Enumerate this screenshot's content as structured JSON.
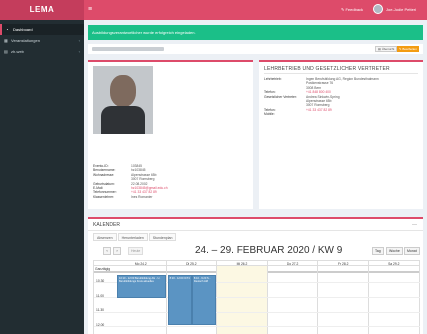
{
  "brand": "LEMA",
  "topbar": {
    "menu_icon": "bars-icon",
    "feedback": "Feedback",
    "user": "Joe-Jodie Petteri"
  },
  "sidebar": {
    "items": [
      {
        "label": "Dashboard",
        "icon": "gauge-icon",
        "active": true
      },
      {
        "label": "Veranstaltungen",
        "icon": "calendar-icon",
        "chevron": "‹"
      },
      {
        "label": "zh-web",
        "icon": "grid-icon",
        "chevron": "‹"
      }
    ]
  },
  "alert": "Ausbildungsverantwortlicher wurde erfolgreich eingeladen.",
  "toolbar": {
    "print_label": "Übersicht",
    "edit_label": "Bearbeiten"
  },
  "person": {
    "rows": [
      {
        "label": "Evento-ID:",
        "value": "103845"
      },
      {
        "label": "Benutzername:",
        "value": "hz103845"
      },
      {
        "label": "Wohnadresse:",
        "value": "Alpenstrasse 65b"
      },
      {
        "label": "",
        "value": "3007 Romsberg"
      },
      {
        "label": "Geburtsdatum:",
        "value": "22.08.2002"
      },
      {
        "label": "E-Mail:",
        "value": "hz103845@gmail.edu.ch",
        "link": true
      },
      {
        "label": "Telefonnummer:",
        "value": "+41 33 437 82 89",
        "link": true
      },
      {
        "label": "Klassenlehrer:",
        "value": "Ines Romanier"
      }
    ]
  },
  "company": {
    "title": "LEHRBETRIEB UND GESETZLICHER VERTRETER",
    "rows": [
      {
        "label": "Lehrbetrieb:",
        "lines": [
          "Ingen Berufsbildung AG, Region Bundesthalmann",
          "Postkenstrasse 76",
          "3008 Bern"
        ]
      },
      {
        "label": "Telefon:",
        "lines": [
          "+41 848 800 400"
        ],
        "link": true
      },
      {
        "label": "Gesetzlicher Vertreter:",
        "lines": [
          "Andrea Sinkwin-Spring",
          "Alpenstrasse 65b",
          "3007 Romsberg"
        ]
      },
      {
        "label": "Telefon:",
        "lines": [
          "+41 33 437 82 89"
        ],
        "link": true
      },
      {
        "label": "Mobile:",
        "lines": [
          ""
        ]
      }
    ]
  },
  "calendar": {
    "title": "KALENDER",
    "collapse": "—",
    "tabs": [
      "Absenzen",
      "Herunterladen",
      "Stundenplan"
    ],
    "prev": "‹",
    "next": "›",
    "today": "Heute",
    "range": "24. – 29. FEBRUAR 2020 / KW 9",
    "views": [
      "Tag",
      "Woche",
      "Monat"
    ],
    "days": [
      "Mo 24.2",
      "Di 25.2",
      "Mi 26.2",
      "Do 27.2",
      "Fr 28.2",
      "Sa 29.2"
    ],
    "allday": "Ganztägig",
    "times": [
      "10.30",
      "11.00",
      "11.30",
      "12.00"
    ],
    "events": [
      {
        "day": 0,
        "text": "10:10 - 12:00 Berufsbildung AG - U-Berufsbildungs Kreis aktuelles",
        "start": 0,
        "end": 1.6
      },
      {
        "day": 1,
        "text": "8:10 - 12:00 ICT4",
        "start": 0,
        "end": 3.4
      },
      {
        "day": 1,
        "text": "8:10 - 9:20 S - Deutsch AM",
        "start": 0,
        "end": 3.4,
        "half": true
      }
    ]
  }
}
